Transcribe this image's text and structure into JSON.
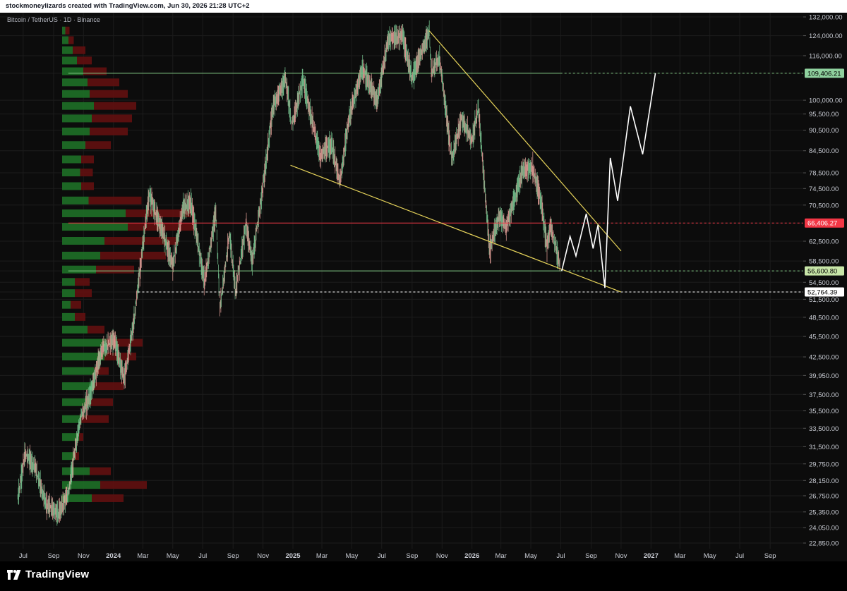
{
  "header": {
    "attribution": "stockmoneylizards created with TradingView.com, Jun 30, 2026 21:28 UTC+2"
  },
  "chart": {
    "symbol": "Bitcoin / TetherUS · 1D · Binance"
  },
  "footer": {
    "logo_text": "TradingView"
  },
  "colors": {
    "up": "#26a69a",
    "down": "#ef5350",
    "candle": "#f0a8a0",
    "trend": "#e6d35a",
    "red_level": "#f23645",
    "green_level": "#81c784",
    "vp_up": "#1e6b26",
    "vp_down": "#5e1010"
  },
  "chart_data": {
    "type": "candlestick",
    "y_scale": "log",
    "ylim": [
      22850,
      132000
    ],
    "x_range": [
      "2023-06-01",
      "2027-10-10"
    ],
    "y_ticks": [
      "132,000.00",
      "124,000.00",
      "116,000.00",
      "109,406.21",
      "100,000.00",
      "95,500.00",
      "90,500.00",
      "84,500.00",
      "78,500.00",
      "74,500.00",
      "70,500.00",
      "66,406.27",
      "62,500.00",
      "58,500.00",
      "56,600.80",
      "54,500.00",
      "52,764.39",
      "51,500.00",
      "48,500.00",
      "45,500.00",
      "42,500.00",
      "39,950.00",
      "37,500.00",
      "35,500.00",
      "33,500.00",
      "31,500.00",
      "29,750.00",
      "28,150.00",
      "26,750.00",
      "25,350.00",
      "24,050.00",
      "22,850.00"
    ],
    "x_ticks": [
      "Jul",
      "Sep",
      "Nov",
      "2024",
      "Mar",
      "May",
      "Jul",
      "Sep",
      "Nov",
      "2025",
      "Mar",
      "May",
      "Jul",
      "Sep",
      "Nov",
      "2026",
      "Mar",
      "May",
      "Jul",
      "Sep",
      "Nov",
      "2027",
      "Mar",
      "May",
      "Jul",
      "Sep"
    ],
    "price_path": [
      [
        "2023-06-20",
        26500
      ],
      [
        "2023-07-05",
        30800
      ],
      [
        "2023-07-25",
        29500
      ],
      [
        "2023-08-17",
        26000
      ],
      [
        "2023-09-11",
        25200
      ],
      [
        "2023-10-01",
        27000
      ],
      [
        "2023-10-25",
        34500
      ],
      [
        "2023-11-15",
        37500
      ],
      [
        "2023-12-08",
        43500
      ],
      [
        "2024-01-03",
        45000
      ],
      [
        "2024-01-23",
        39500
      ],
      [
        "2024-02-12",
        48000
      ],
      [
        "2024-02-28",
        60000
      ],
      [
        "2024-03-14",
        73000
      ],
      [
        "2024-04-15",
        63000
      ],
      [
        "2024-05-01",
        57500
      ],
      [
        "2024-05-22",
        70000
      ],
      [
        "2024-06-07",
        71000
      ],
      [
        "2024-07-05",
        54500
      ],
      [
        "2024-07-28",
        69000
      ],
      [
        "2024-08-05",
        50000
      ],
      [
        "2024-08-25",
        64000
      ],
      [
        "2024-09-06",
        53000
      ],
      [
        "2024-09-27",
        66000
      ],
      [
        "2024-10-10",
        58500
      ],
      [
        "2024-10-29",
        72500
      ],
      [
        "2024-11-22",
        98500
      ],
      [
        "2024-12-17",
        107500
      ],
      [
        "2024-12-30",
        92000
      ],
      [
        "2025-01-21",
        107000
      ],
      [
        "2025-02-26",
        83000
      ],
      [
        "2025-03-20",
        86500
      ],
      [
        "2025-04-07",
        76000
      ],
      [
        "2025-04-25",
        94000
      ],
      [
        "2025-05-22",
        111000
      ],
      [
        "2025-06-22",
        99500
      ],
      [
        "2025-07-14",
        122500
      ],
      [
        "2025-08-13",
        124000
      ],
      [
        "2025-09-01",
        107500
      ],
      [
        "2025-10-06",
        126000
      ],
      [
        "2025-10-10",
        110000
      ],
      [
        "2025-10-27",
        115000
      ],
      [
        "2025-11-21",
        82000
      ],
      [
        "2025-12-10",
        94000
      ],
      [
        "2026-01-01",
        87500
      ],
      [
        "2026-01-14",
        97500
      ],
      [
        "2026-02-06",
        60500
      ],
      [
        "2026-02-25",
        68000
      ],
      [
        "2026-03-12",
        65500
      ],
      [
        "2026-04-14",
        79000
      ],
      [
        "2026-05-05",
        80000
      ],
      [
        "2026-05-20",
        72500
      ],
      [
        "2026-06-03",
        61500
      ],
      [
        "2026-06-10",
        66000
      ],
      [
        "2026-06-30",
        57500
      ]
    ],
    "projection": [
      [
        "2026-07-03",
        56600
      ],
      [
        "2026-07-20",
        63500
      ],
      [
        "2026-08-01",
        59500
      ],
      [
        "2026-08-22",
        68500
      ],
      [
        "2026-09-05",
        61000
      ],
      [
        "2026-09-15",
        66000
      ],
      [
        "2026-09-29",
        53500
      ],
      [
        "2026-10-10",
        82500
      ],
      [
        "2026-10-25",
        71500
      ],
      [
        "2026-11-20",
        98000
      ],
      [
        "2026-12-15",
        83500
      ],
      [
        "2027-01-10",
        109406
      ]
    ],
    "horizontal_levels": [
      {
        "price": 109406.21,
        "label": "109,406.21",
        "color": "#81c784",
        "box_bg": "#8fd19e"
      },
      {
        "price": 66406.27,
        "label": "66,406.27",
        "color": "#f23645",
        "box_bg": "#f23645"
      },
      {
        "price": 56600.8,
        "label": "56,600.80",
        "color": "#81c784",
        "box_bg": "#c8e6a8"
      },
      {
        "price": 52764.39,
        "label": "52,764.39",
        "color": "#ffffff",
        "box_bg": "#ffffff"
      }
    ],
    "trendlines": [
      {
        "from": [
          "2025-10-06",
          126000
        ],
        "to": [
          "2026-11-01",
          60500
        ]
      },
      {
        "from": [
          "2024-12-27",
          80500
        ],
        "to": [
          "2026-11-01",
          52764
        ]
      }
    ],
    "volume_profile": [
      {
        "price": 126000,
        "up": 3,
        "down": 4
      },
      {
        "price": 122000,
        "up": 6,
        "down": 5
      },
      {
        "price": 118000,
        "up": 10,
        "down": 12
      },
      {
        "price": 114000,
        "up": 14,
        "down": 14
      },
      {
        "price": 110000,
        "up": 20,
        "down": 22
      },
      {
        "price": 106000,
        "up": 24,
        "down": 30
      },
      {
        "price": 102000,
        "up": 26,
        "down": 36
      },
      {
        "price": 98000,
        "up": 30,
        "down": 40
      },
      {
        "price": 94000,
        "up": 28,
        "down": 38
      },
      {
        "price": 90000,
        "up": 26,
        "down": 36
      },
      {
        "price": 86000,
        "up": 22,
        "down": 24
      },
      {
        "price": 82000,
        "up": 18,
        "down": 12
      },
      {
        "price": 78500,
        "up": 17,
        "down": 12
      },
      {
        "price": 75000,
        "up": 18,
        "down": 12
      },
      {
        "price": 71500,
        "up": 25,
        "down": 50
      },
      {
        "price": 68500,
        "up": 60,
        "down": 62
      },
      {
        "price": 65500,
        "up": 62,
        "down": 62
      },
      {
        "price": 62500,
        "up": 40,
        "down": 70
      },
      {
        "price": 59500,
        "up": 36,
        "down": 62
      },
      {
        "price": 56800,
        "up": 32,
        "down": 36
      },
      {
        "price": 54500,
        "up": 12,
        "down": 14
      },
      {
        "price": 52500,
        "up": 12,
        "down": 16
      },
      {
        "price": 50500,
        "up": 8,
        "down": 10
      },
      {
        "price": 48500,
        "up": 12,
        "down": 10
      },
      {
        "price": 46500,
        "up": 24,
        "down": 16
      },
      {
        "price": 44500,
        "up": 40,
        "down": 36
      },
      {
        "price": 42500,
        "up": 40,
        "down": 30
      },
      {
        "price": 40500,
        "up": 30,
        "down": 14
      },
      {
        "price": 38500,
        "up": 30,
        "down": 28
      },
      {
        "price": 36500,
        "up": 22,
        "down": 26
      },
      {
        "price": 34500,
        "up": 18,
        "down": 26
      },
      {
        "price": 32500,
        "up": 16,
        "down": 4
      },
      {
        "price": 30500,
        "up": 12,
        "down": 4
      },
      {
        "price": 29000,
        "up": 26,
        "down": 20
      },
      {
        "price": 27700,
        "up": 36,
        "down": 44
      },
      {
        "price": 26500,
        "up": 28,
        "down": 30
      }
    ]
  }
}
